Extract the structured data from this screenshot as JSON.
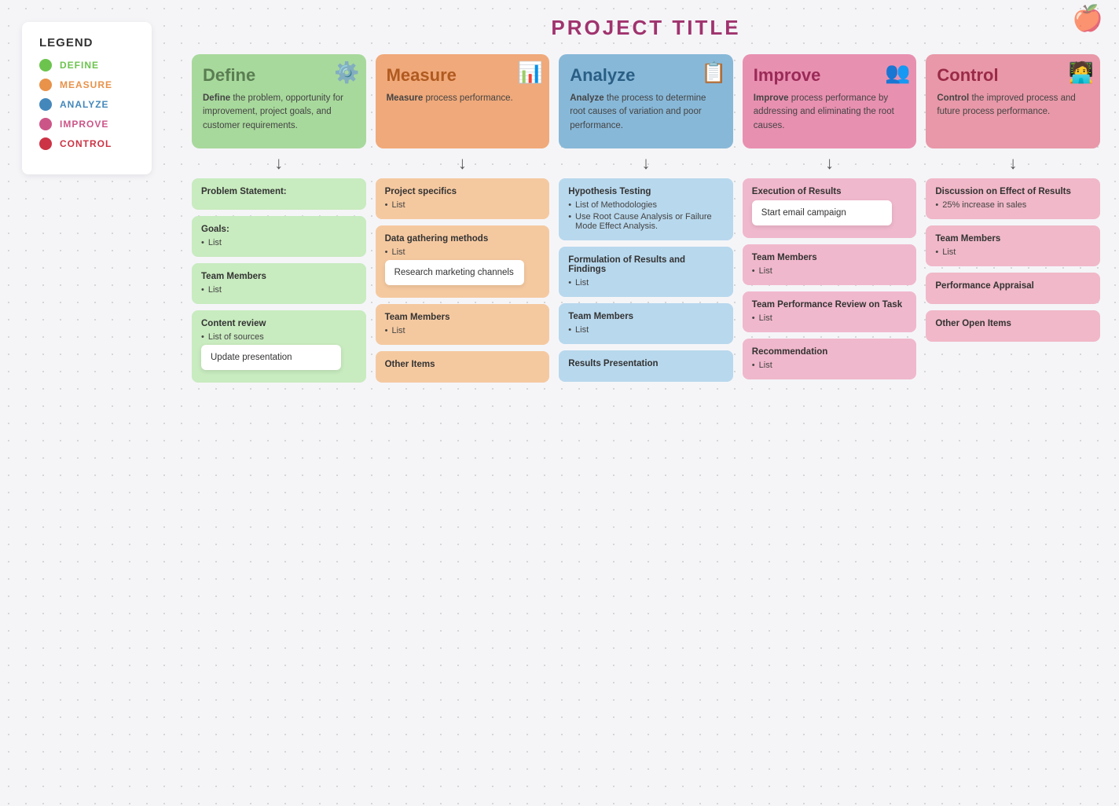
{
  "legend": {
    "title": "LEGEND",
    "items": [
      {
        "label": "DEFINE",
        "color": "#6cc44e"
      },
      {
        "label": "MEASURE",
        "color": "#e8924a"
      },
      {
        "label": "ANALYZE",
        "color": "#4488bb"
      },
      {
        "label": "IMPROVE",
        "color": "#cc5588"
      },
      {
        "label": "CONTROL",
        "color": "#cc3344"
      }
    ]
  },
  "project_title": "PROJECT TITLE",
  "columns": [
    {
      "id": "define",
      "header": {
        "title": "Define",
        "icon": "⚙️",
        "body_bold": "Define",
        "body_rest": " the problem, opportunity for improvement, project goals, and customer requirements."
      },
      "sections": [
        {
          "title": "Problem Statement:",
          "items": []
        },
        {
          "title": "Goals:",
          "items": [
            "List"
          ]
        },
        {
          "title": "Team Members",
          "items": [
            "List"
          ]
        },
        {
          "title": "Content review",
          "items": [
            "List of sources"
          ],
          "sticky": "Update presentation"
        }
      ]
    },
    {
      "id": "measure",
      "header": {
        "title": "Measure",
        "icon": "📊",
        "body_bold": "Measure",
        "body_rest": " process performance."
      },
      "sections": [
        {
          "title": "Project specifics",
          "items": [
            "List"
          ]
        },
        {
          "title": "Data gathering methods",
          "items": [
            "List"
          ],
          "sticky": "Research marketing channels"
        },
        {
          "title": "Team Members",
          "items": [
            "List"
          ]
        },
        {
          "title": "Other Items",
          "items": []
        }
      ]
    },
    {
      "id": "analyze",
      "header": {
        "title": "Analyze",
        "icon": "📋",
        "body_bold": "Analyze",
        "body_rest": " the process to determine root causes of variation and poor performance."
      },
      "sections": [
        {
          "title": "Hypothesis Testing",
          "items": [
            "List of Methodologies",
            "Use Root Cause Analysis or Failure Mode Effect Analysis."
          ]
        },
        {
          "title": "Formulation of Results and Findings",
          "items": [
            "List"
          ]
        },
        {
          "title": "Team Members",
          "items": [
            "List"
          ]
        },
        {
          "title": "Results Presentation",
          "items": []
        }
      ]
    },
    {
      "id": "improve",
      "header": {
        "title": "Improve",
        "icon": "👥",
        "body_bold": "Improve",
        "body_rest": " process performance by addressing and eliminating the root causes."
      },
      "sections": [
        {
          "title": "Execution of Results",
          "items": [],
          "sticky": "Start email campaign"
        },
        {
          "title": "Team Members",
          "items": [
            "List"
          ]
        },
        {
          "title": "Team Performance Review on Task",
          "items": [
            "List"
          ]
        },
        {
          "title": "Recommendation",
          "items": [
            "List"
          ]
        }
      ]
    },
    {
      "id": "control",
      "header": {
        "title": "Control",
        "icon": "🧑‍💻",
        "body_bold": "Control",
        "body_rest": " the improved process and future process performance."
      },
      "sections": [
        {
          "title": "Discussion on Effect of Results",
          "items": [
            "25% increase in sales"
          ]
        },
        {
          "title": "Team Members",
          "items": [
            "List"
          ]
        },
        {
          "title": "Performance Appraisal",
          "items": []
        },
        {
          "title": "Other Open Items",
          "items": []
        }
      ]
    }
  ]
}
